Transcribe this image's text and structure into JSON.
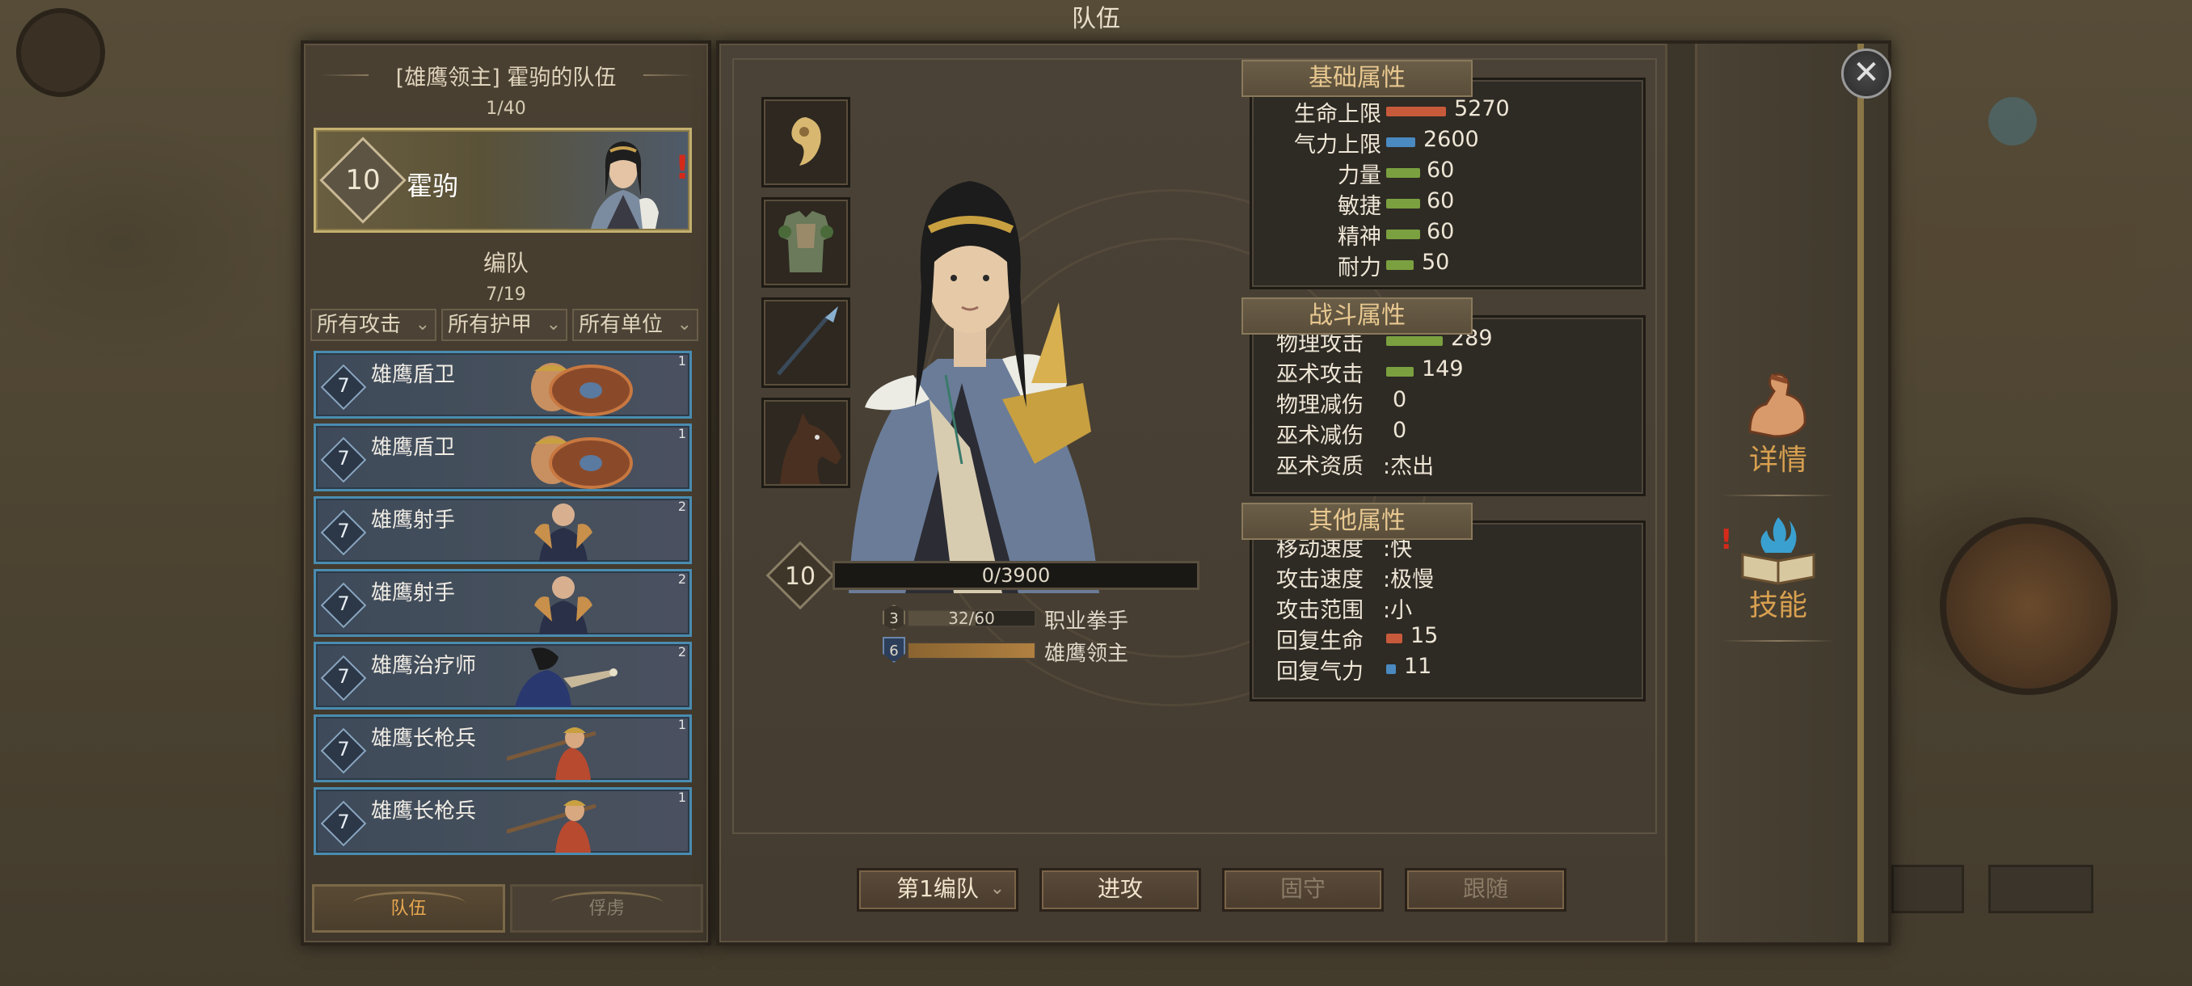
{
  "header": {
    "title": "队伍"
  },
  "party": {
    "title": "[雄鹰领主] 霍驹的队伍",
    "count": "1/40",
    "hero": {
      "level": "10",
      "name": "霍驹",
      "alert": "!"
    },
    "section_label": "编队",
    "section_count": "7/19",
    "filters": [
      "所有攻击",
      "所有护甲",
      "所有单位"
    ],
    "units": [
      {
        "level": "7",
        "name": "雄鹰盾卫",
        "tier": "1"
      },
      {
        "level": "7",
        "name": "雄鹰盾卫",
        "tier": "1"
      },
      {
        "level": "7",
        "name": "雄鹰射手",
        "tier": "2"
      },
      {
        "level": "7",
        "name": "雄鹰射手",
        "tier": "2"
      },
      {
        "level": "7",
        "name": "雄鹰治疗师",
        "tier": "2"
      },
      {
        "level": "7",
        "name": "雄鹰长枪兵",
        "tier": "1"
      },
      {
        "level": "7",
        "name": "雄鹰长枪兵",
        "tier": "1"
      }
    ],
    "tabs": [
      "队伍",
      "俘虏"
    ]
  },
  "character": {
    "level": "10",
    "xp": "0/3900",
    "class_badge": "3",
    "class_progress": "32/60",
    "class_progress_value": 0.53,
    "class_name": "职业拳手",
    "title_badge": "6",
    "title_progress_value": 1.0,
    "title_name": "雄鹰领主"
  },
  "stats": {
    "basic": {
      "header": "基础属性",
      "rows": [
        {
          "name": "生命上限",
          "value": "5270",
          "color": "#c85a3c"
        },
        {
          "name": "气力上限",
          "value": "2600",
          "color": "#4a8ac0"
        },
        {
          "name": "力量",
          "value": "60",
          "color": "#7aa040"
        },
        {
          "name": "敏捷",
          "value": "60",
          "color": "#7aa040"
        },
        {
          "name": "精神",
          "value": "60",
          "color": "#7aa040"
        },
        {
          "name": "耐力",
          "value": "50",
          "color": "#7aa040"
        }
      ]
    },
    "combat": {
      "header": "战斗属性",
      "rows": [
        {
          "name": "物理攻击",
          "value": "289",
          "color": "#7aa040"
        },
        {
          "name": "巫术攻击",
          "value": "149",
          "color": "#7aa040"
        },
        {
          "name": "物理减伤",
          "value": "0"
        },
        {
          "name": "巫术减伤",
          "value": "0"
        },
        {
          "name": "巫术资质",
          "value": ":杰出"
        }
      ]
    },
    "other": {
      "header": "其他属性",
      "rows": [
        {
          "name": "移动速度",
          "value": ":快"
        },
        {
          "name": "攻击速度",
          "value": ":极慢"
        },
        {
          "name": "攻击范围",
          "value": ":小"
        },
        {
          "name": "回复生命",
          "value": "15",
          "color": "#c85a3c"
        },
        {
          "name": "回复气力",
          "value": "11",
          "color": "#4a8ac0"
        }
      ]
    }
  },
  "side_tabs": [
    {
      "label": "详情",
      "icon": "flexed-arm-icon"
    },
    {
      "label": "技能",
      "icon": "spell-book-icon",
      "alert": "!"
    }
  ],
  "bottom": {
    "formation": "第1编队",
    "attack": "进攻",
    "hold": "固守",
    "follow": "跟随"
  }
}
